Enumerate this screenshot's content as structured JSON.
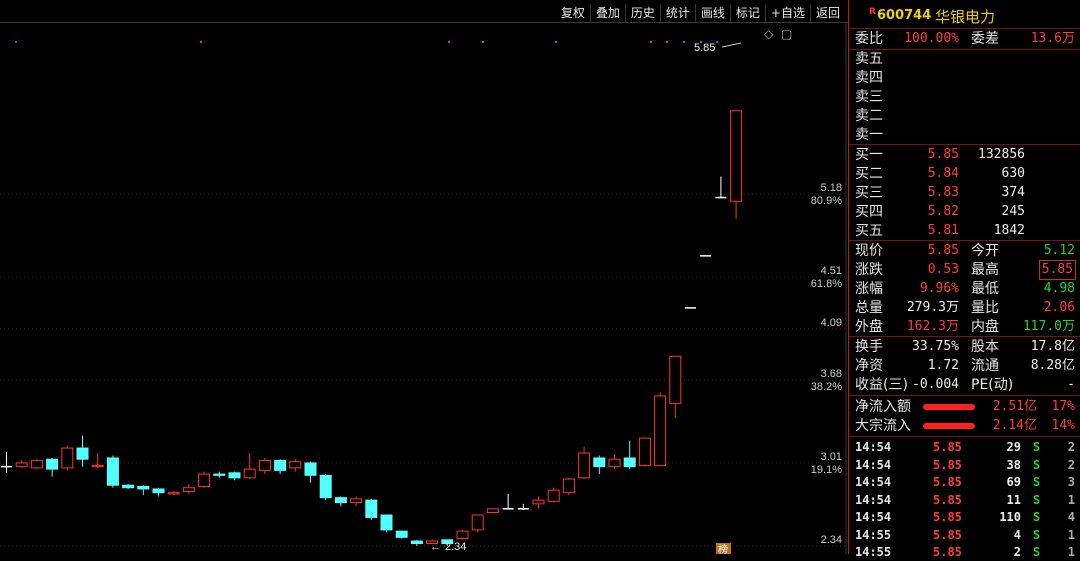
{
  "toolbar": [
    "复权",
    "叠加",
    "历史",
    "统计",
    "画线",
    "标记",
    "+自选",
    "返回"
  ],
  "chart_icons": {
    "diamond": "◇",
    "window": "▢"
  },
  "price_axis": [
    {
      "price": "5.18",
      "pct": "80.9%"
    },
    {
      "price": "4.51",
      "pct": "61.8%"
    },
    {
      "price": "4.09",
      "pct": ""
    },
    {
      "price": "3.68",
      "pct": "38.2%"
    },
    {
      "price": "3.01",
      "pct": "19.1%"
    },
    {
      "price": "2.34",
      "pct": ""
    }
  ],
  "annotations": {
    "high": "5.85",
    "low": "2.34",
    "high_arrow": "←",
    "low_arrow": "←"
  },
  "bottom_badge": "榜",
  "candles": [
    {
      "o": 2.98,
      "c": 2.98,
      "h": 3.1,
      "l": 2.93
    },
    {
      "o": 2.98,
      "c": 3.01,
      "h": 3.03,
      "l": 2.97
    },
    {
      "o": 2.97,
      "c": 3.03,
      "h": 3.04,
      "l": 2.96
    },
    {
      "o": 3.04,
      "c": 2.96,
      "h": 3.05,
      "l": 2.9
    },
    {
      "o": 2.97,
      "c": 3.13,
      "h": 3.15,
      "l": 2.95
    },
    {
      "o": 3.13,
      "c": 3.04,
      "h": 3.23,
      "l": 2.98
    },
    {
      "o": 2.98,
      "c": 2.99,
      "h": 3.09,
      "l": 2.97
    },
    {
      "o": 3.05,
      "c": 2.83,
      "h": 3.07,
      "l": 2.81
    },
    {
      "o": 2.83,
      "c": 2.81,
      "h": 2.84,
      "l": 2.8
    },
    {
      "o": 2.82,
      "c": 2.8,
      "h": 2.83,
      "l": 2.75
    },
    {
      "o": 2.8,
      "c": 2.77,
      "h": 2.81,
      "l": 2.74
    },
    {
      "o": 2.76,
      "c": 2.77,
      "h": 2.78,
      "l": 2.75
    },
    {
      "o": 2.78,
      "c": 2.81,
      "h": 2.84,
      "l": 2.76
    },
    {
      "o": 2.82,
      "c": 2.92,
      "h": 2.94,
      "l": 2.81
    },
    {
      "o": 2.92,
      "c": 2.91,
      "h": 2.94,
      "l": 2.89
    },
    {
      "o": 2.93,
      "c": 2.89,
      "h": 2.94,
      "l": 2.87
    },
    {
      "o": 2.89,
      "c": 2.96,
      "h": 3.09,
      "l": 2.88
    },
    {
      "o": 2.95,
      "c": 3.03,
      "h": 3.05,
      "l": 2.92
    },
    {
      "o": 3.03,
      "c": 2.95,
      "h": 3.04,
      "l": 2.92
    },
    {
      "o": 2.97,
      "c": 3.02,
      "h": 3.04,
      "l": 2.94
    },
    {
      "o": 3.01,
      "c": 2.91,
      "h": 3.02,
      "l": 2.85
    },
    {
      "o": 2.91,
      "c": 2.73,
      "h": 2.92,
      "l": 2.71
    },
    {
      "o": 2.73,
      "c": 2.69,
      "h": 2.74,
      "l": 2.66
    },
    {
      "o": 2.69,
      "c": 2.72,
      "h": 2.74,
      "l": 2.66
    },
    {
      "o": 2.71,
      "c": 2.57,
      "h": 2.72,
      "l": 2.55
    },
    {
      "o": 2.59,
      "c": 2.47,
      "h": 2.59,
      "l": 2.45
    },
    {
      "o": 2.46,
      "c": 2.41,
      "h": 2.46,
      "l": 2.4
    },
    {
      "o": 2.38,
      "c": 2.36,
      "h": 2.39,
      "l": 2.34
    },
    {
      "o": 2.36,
      "c": 2.38,
      "h": 2.39,
      "l": 2.36
    },
    {
      "o": 2.39,
      "c": 2.36,
      "h": 2.39,
      "l": 2.34
    },
    {
      "o": 2.4,
      "c": 2.46,
      "h": 2.47,
      "l": 2.4
    },
    {
      "o": 2.47,
      "c": 2.59,
      "h": 2.59,
      "l": 2.45
    },
    {
      "o": 2.61,
      "c": 2.64,
      "h": 2.64,
      "l": 2.61
    },
    {
      "o": 2.64,
      "c": 2.64,
      "h": 2.76,
      "l": 2.64
    },
    {
      "o": 2.64,
      "c": 2.64,
      "h": 2.68,
      "l": 2.63
    },
    {
      "o": 2.68,
      "c": 2.71,
      "h": 2.74,
      "l": 2.64
    },
    {
      "o": 2.7,
      "c": 2.79,
      "h": 2.81,
      "l": 2.69
    },
    {
      "o": 2.77,
      "c": 2.88,
      "h": 2.89,
      "l": 2.75
    },
    {
      "o": 2.89,
      "c": 3.09,
      "h": 3.14,
      "l": 2.88
    },
    {
      "o": 3.05,
      "c": 2.98,
      "h": 3.07,
      "l": 2.92
    },
    {
      "o": 2.98,
      "c": 3.04,
      "h": 3.08,
      "l": 2.96
    },
    {
      "o": 3.05,
      "c": 2.98,
      "h": 3.19,
      "l": 2.96
    },
    {
      "o": 2.99,
      "c": 3.21,
      "h": 3.21,
      "l": 2.98
    },
    {
      "o": 2.99,
      "c": 3.55,
      "h": 3.58,
      "l": 2.99
    },
    {
      "o": 3.49,
      "c": 3.87,
      "h": 3.87,
      "l": 3.37
    },
    {
      "o": 4.26,
      "c": 4.26,
      "h": 4.26,
      "l": 4.26
    },
    {
      "o": 4.68,
      "c": 4.68,
      "h": 4.68,
      "l": 4.68
    },
    {
      "o": 5.15,
      "c": 5.15,
      "h": 5.32,
      "l": 5.15
    },
    {
      "o": 5.12,
      "c": 5.85,
      "h": 5.85,
      "l": 4.98
    }
  ],
  "stock": {
    "code": "600744",
    "name": "华银电力",
    "tag": "R"
  },
  "order_summary": {
    "wei_bi_label": "委比",
    "wei_bi": "100.00%",
    "wei_cha_label": "委差",
    "wei_cha": "13.6万"
  },
  "asks": [
    "卖五",
    "卖四",
    "卖三",
    "卖二",
    "卖一"
  ],
  "bids": [
    {
      "label": "买一",
      "price": "5.85",
      "vol": "132856"
    },
    {
      "label": "买二",
      "price": "5.84",
      "vol": "630"
    },
    {
      "label": "买三",
      "price": "5.83",
      "vol": "374"
    },
    {
      "label": "买四",
      "price": "5.82",
      "vol": "245"
    },
    {
      "label": "买五",
      "price": "5.81",
      "vol": "1842"
    }
  ],
  "quote": [
    {
      "l1": "现价",
      "v1": "5.85",
      "c1": "red",
      "l2": "今开",
      "v2": "5.12",
      "c2": "green"
    },
    {
      "l1": "涨跌",
      "v1": "0.53",
      "c1": "red",
      "l2": "最高",
      "v2": "5.85",
      "c2": "red",
      "boxed": true
    },
    {
      "l1": "涨幅",
      "v1": "9.96%",
      "c1": "red",
      "l2": "最低",
      "v2": "4.98",
      "c2": "green"
    },
    {
      "l1": "总量",
      "v1": "279.3万",
      "c1": "white",
      "l2": "量比",
      "v2": "2.06",
      "c2": "red"
    },
    {
      "l1": "外盘",
      "v1": "162.3万",
      "c1": "red",
      "l2": "内盘",
      "v2": "117.0万",
      "c2": "green"
    }
  ],
  "fundamentals": [
    {
      "l1": "换手",
      "v1": "33.75%",
      "l2": "股本",
      "v2": "17.8亿"
    },
    {
      "l1": "净资",
      "v1": "1.72",
      "l2": "流通",
      "v2": "8.28亿"
    },
    {
      "l1": "收益(三)",
      "v1": "-0.004",
      "l2": "PE(动)",
      "v2": "-"
    }
  ],
  "flows": [
    {
      "label": "净流入额",
      "amount": "2.51亿",
      "pct": "17%",
      "bar": 0.72
    },
    {
      "label": "大宗流入",
      "amount": "2.14亿",
      "pct": "14%",
      "bar": 0.72
    }
  ],
  "ticks": [
    {
      "time": "14:54",
      "price": "5.85",
      "vol": "29",
      "side": "S",
      "n": "2"
    },
    {
      "time": "14:54",
      "price": "5.85",
      "vol": "38",
      "side": "S",
      "n": "2"
    },
    {
      "time": "14:54",
      "price": "5.85",
      "vol": "69",
      "side": "S",
      "n": "3"
    },
    {
      "time": "14:54",
      "price": "5.85",
      "vol": "11",
      "side": "S",
      "n": "1"
    },
    {
      "time": "14:54",
      "price": "5.85",
      "vol": "110",
      "side": "S",
      "n": "4"
    },
    {
      "time": "14:55",
      "price": "5.85",
      "vol": "4",
      "side": "S",
      "n": "1"
    },
    {
      "time": "14:55",
      "price": "5.85",
      "vol": "2",
      "side": "S",
      "n": "1"
    }
  ]
}
